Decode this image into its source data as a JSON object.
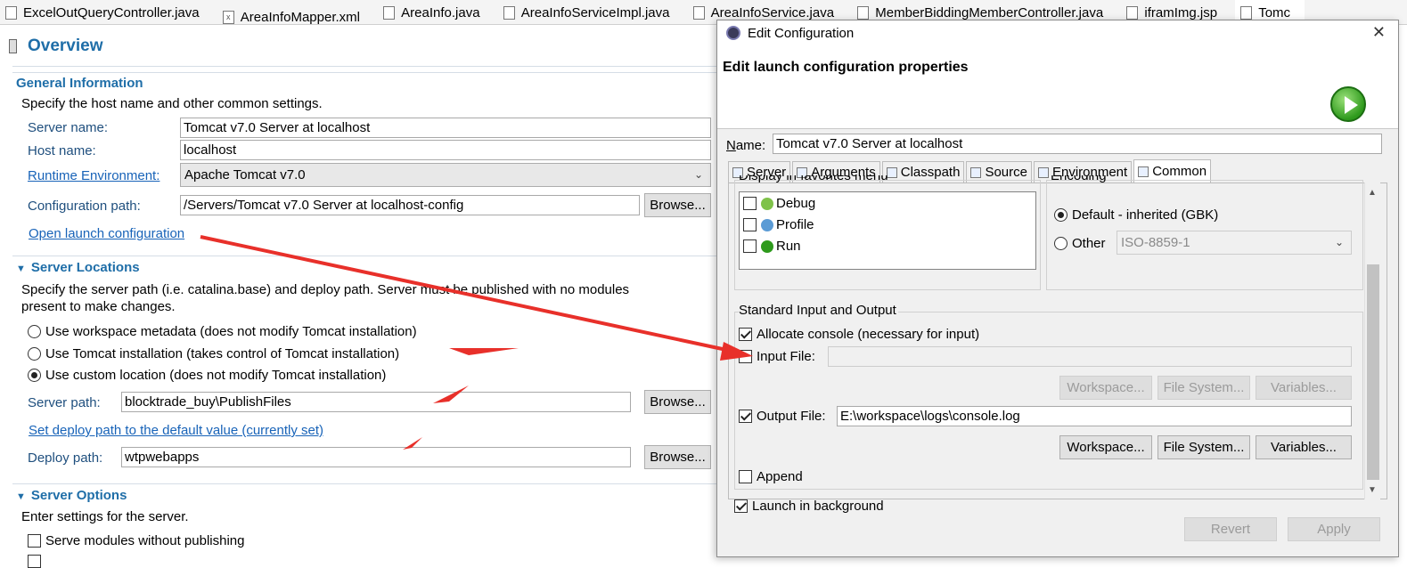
{
  "tabs": [
    {
      "label": "ExcelOutQueryController.java",
      "icon": "java-file-icon"
    },
    {
      "label": "AreaInfoMapper.xml",
      "icon": "xml-file-icon"
    },
    {
      "label": "AreaInfo.java",
      "icon": "java-file-icon"
    },
    {
      "label": "AreaInfoServiceImpl.java",
      "icon": "java-file-icon"
    },
    {
      "label": "AreaInfoService.java",
      "icon": "java-file-icon"
    },
    {
      "label": "MemberBiddingMemberController.java",
      "icon": "java-file-icon"
    },
    {
      "label": "iframImg.jsp",
      "icon": "jsp-file-icon"
    },
    {
      "label": "Tomc",
      "icon": "server-file-icon"
    }
  ],
  "overview": {
    "title": "Overview",
    "general": {
      "heading": "General Information",
      "desc": "Specify the host name and other common settings.",
      "server_name_label": "Server name:",
      "server_name": "Tomcat v7.0 Server at localhost",
      "host_name_label": "Host name:",
      "host_name": "localhost",
      "runtime_label": "Runtime Environment:",
      "runtime": "Apache Tomcat v7.0",
      "config_path_label": "Configuration path:",
      "config_path": "/Servers/Tomcat v7.0 Server at localhost-config",
      "browse": "Browse...",
      "open_launch": "Open launch configuration"
    },
    "locations": {
      "heading": "Server Locations",
      "desc1": "Specify the server path (i.e. catalina.base) and deploy path. Server must be published with no modules",
      "desc2": "present to make changes.",
      "opt_workspace": "Use workspace metadata (does not modify Tomcat installation)",
      "opt_tomcat": "Use Tomcat installation (takes control of Tomcat installation)",
      "opt_custom": "Use custom location (does not modify Tomcat installation)",
      "server_path_label": "Server path:",
      "server_path": "blocktrade_buy\\PublishFiles",
      "browse": "Browse...",
      "set_default": "Set deploy path to the default value (currently set)",
      "deploy_path_label": "Deploy path:",
      "deploy_path": "wtpwebapps"
    },
    "options": {
      "heading": "Server Options",
      "desc": "Enter settings for the server.",
      "serve_modules": "Serve modules without publishing"
    }
  },
  "dialog": {
    "title": "Edit Configuration",
    "close": "✕",
    "header": "Edit launch configuration properties",
    "name_label": "Name:",
    "name_value": "Tomcat v7.0 Server at localhost",
    "tabs": [
      "Server",
      "Arguments",
      "Classpath",
      "Source",
      "Environment",
      "Common"
    ],
    "favorites": {
      "heading": "Display in favorites menu",
      "items": [
        "Debug",
        "Profile",
        "Run"
      ]
    },
    "encoding": {
      "heading": "Encoding",
      "default": "Default - inherited (GBK)",
      "other": "Other",
      "other_value": "ISO-8859-1"
    },
    "stdio": {
      "heading": "Standard Input and Output",
      "allocate": "Allocate console (necessary for input)",
      "input_file": "Input File:",
      "output_file": "Output File:",
      "output_value": "E:\\workspace\\logs\\console.log",
      "workspace": "Workspace...",
      "file_system": "File System...",
      "variables": "Variables...",
      "append": "Append"
    },
    "launch_bg": "Launch in background",
    "revert": "Revert",
    "apply": "Apply"
  },
  "colors": {
    "section_heading": "#1f6ea8",
    "link": "#1863b8",
    "annotation_arrow": "#e8302a"
  }
}
